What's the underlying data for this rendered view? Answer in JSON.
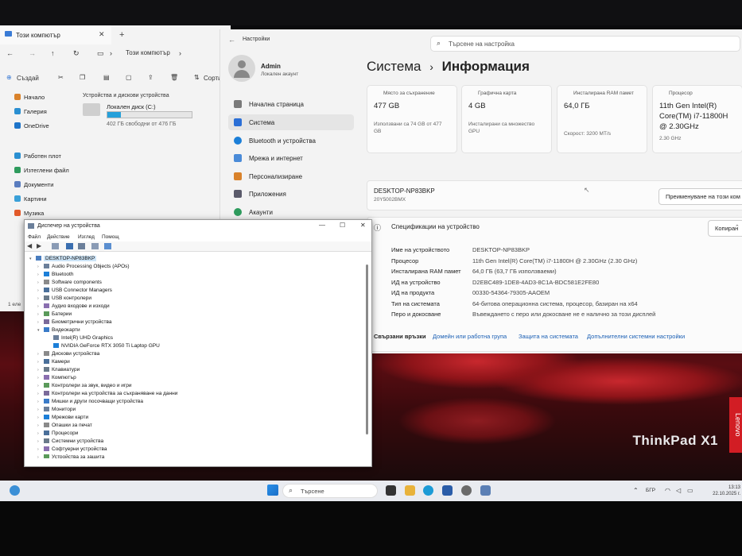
{
  "explorer": {
    "tab_title": "Този компютър",
    "address": "Този компютър",
    "create_label": "Създай",
    "sort_label": "Сорти",
    "sidebar": [
      "Начало",
      "Галерия",
      "OneDrive",
      "Работен плот",
      "Изтеглени файл",
      "Документи",
      "Картини",
      "Музика"
    ],
    "section_label": "Устройства и дискови устройства",
    "disk_name": "Локален диск (C:)",
    "disk_free": "402 ГБ свободни от 476 ГБ",
    "disk_used_fraction": 0.16,
    "status_fragment": "1 еле"
  },
  "settings": {
    "window_title": "Настройки",
    "search_placeholder": "Търсене на настройка",
    "user_name": "Admin",
    "user_type": "Локален акаунт",
    "nav": [
      "Начална страница",
      "Система",
      "Bluetooth и устройства",
      "Мрежа и интернет",
      "Персонализиране",
      "Приложения",
      "Акаунти"
    ],
    "breadcrumb_parent": "Система",
    "breadcrumb_sep": "›",
    "breadcrumb_current": "Информация",
    "cards": [
      {
        "label": "Място за съхранение",
        "value": "477 GB",
        "sub": "Използвани са 74 GB от 477 GB"
      },
      {
        "label": "Графична карта",
        "value": "4 GB",
        "sub": "Инсталирани са множество GPU"
      },
      {
        "label": "Инсталирана RAM памет",
        "value": "64,0 ГБ",
        "sub": "Скорост: 3200 MT/s"
      },
      {
        "label": "Процесор",
        "value": "11th Gen Intel(R) Core(TM) i7-11800H @ 2.30GHz",
        "sub": "2.30 GHz"
      }
    ],
    "device_name": "DESKTOP-NP83BKP",
    "device_model": "20Y5002BMX",
    "rename_button": "Преименуване на този ком",
    "specs_title": "Спецификации на устройство",
    "copy_button": "Копиран",
    "specs": [
      {
        "k": "Име на устройството",
        "v": "DESKTOP-NP83BKP"
      },
      {
        "k": "Процесор",
        "v": "11th Gen Intel(R) Core(TM) i7-11800H @ 2.30GHz (2.30 GHz)"
      },
      {
        "k": "Инсталирана RAM памет",
        "v": "64,0 ГБ (63,7 ГБ използваеми)"
      },
      {
        "k": "ИД на устройство",
        "v": "D2EBC489-1DE8-4AD3-8C1A-BDC581E2FE80"
      },
      {
        "k": "ИД на продукта",
        "v": "00330-54364-79305-AAOEM"
      },
      {
        "k": "Тип на системата",
        "v": "64-битова операционна система, процесор, базиран на x64"
      },
      {
        "k": "Перо и докосване",
        "v": "Въвеждането с перо или докосване не е налично за този дисплей"
      }
    ],
    "links": [
      "Свързани връзки",
      "Домейн или работна група",
      "Защита на системата",
      "Допълнителни системни настройки"
    ]
  },
  "device_manager": {
    "title": "Диспечер на устройства",
    "menu": [
      "Файл",
      "Действие",
      "Изглед",
      "Помощ"
    ],
    "root": "DESKTOP-NP83BKP",
    "nodes": [
      {
        "label": "Audio Processing Objects (APOs)",
        "level": 1,
        "expanded": false
      },
      {
        "label": "Bluetooth",
        "level": 1,
        "expanded": false
      },
      {
        "label": "Software components",
        "level": 1,
        "expanded": false
      },
      {
        "label": "USB Connector Managers",
        "level": 1,
        "expanded": false
      },
      {
        "label": "USB контролери",
        "level": 1,
        "expanded": false
      },
      {
        "label": "Аудио входове и изходи",
        "level": 1,
        "expanded": false
      },
      {
        "label": "Батерии",
        "level": 1,
        "expanded": false
      },
      {
        "label": "Биометрични устройства",
        "level": 1,
        "expanded": false
      },
      {
        "label": "Видеокарти",
        "level": 1,
        "expanded": true
      },
      {
        "label": "Intel(R) UHD Graphics",
        "level": 2,
        "expanded": false
      },
      {
        "label": "NVIDIA GeForce RTX 3050 Ti Laptop GPU",
        "level": 2,
        "expanded": false
      },
      {
        "label": "Дискови устройства",
        "level": 1,
        "expanded": false
      },
      {
        "label": "Камери",
        "level": 1,
        "expanded": false
      },
      {
        "label": "Клавиатури",
        "level": 1,
        "expanded": false
      },
      {
        "label": "Компютър",
        "level": 1,
        "expanded": false
      },
      {
        "label": "Контролери за звук, видео и игри",
        "level": 1,
        "expanded": false
      },
      {
        "label": "Контролери на устройства за съхраняване на данни",
        "level": 1,
        "expanded": false
      },
      {
        "label": "Мишки и други посочващи устройства",
        "level": 1,
        "expanded": false
      },
      {
        "label": "Монитори",
        "level": 1,
        "expanded": false
      },
      {
        "label": "Мрежови карти",
        "level": 1,
        "expanded": false
      },
      {
        "label": "Опашки за печат",
        "level": 1,
        "expanded": false
      },
      {
        "label": "Процесори",
        "level": 1,
        "expanded": false
      },
      {
        "label": "Системни устройства",
        "level": 1,
        "expanded": false
      },
      {
        "label": "Софтуерни устройства",
        "level": 1,
        "expanded": false
      },
      {
        "label": "Устройства за защита",
        "level": 1,
        "expanded": false
      }
    ]
  },
  "taskbar": {
    "search_placeholder": "Търсене",
    "lang": "БГР",
    "time": "13:13",
    "date": "22.10.2025 г."
  },
  "wallpaper": {
    "brand": "ThinkPad X1",
    "vendor": "Lenovo"
  }
}
